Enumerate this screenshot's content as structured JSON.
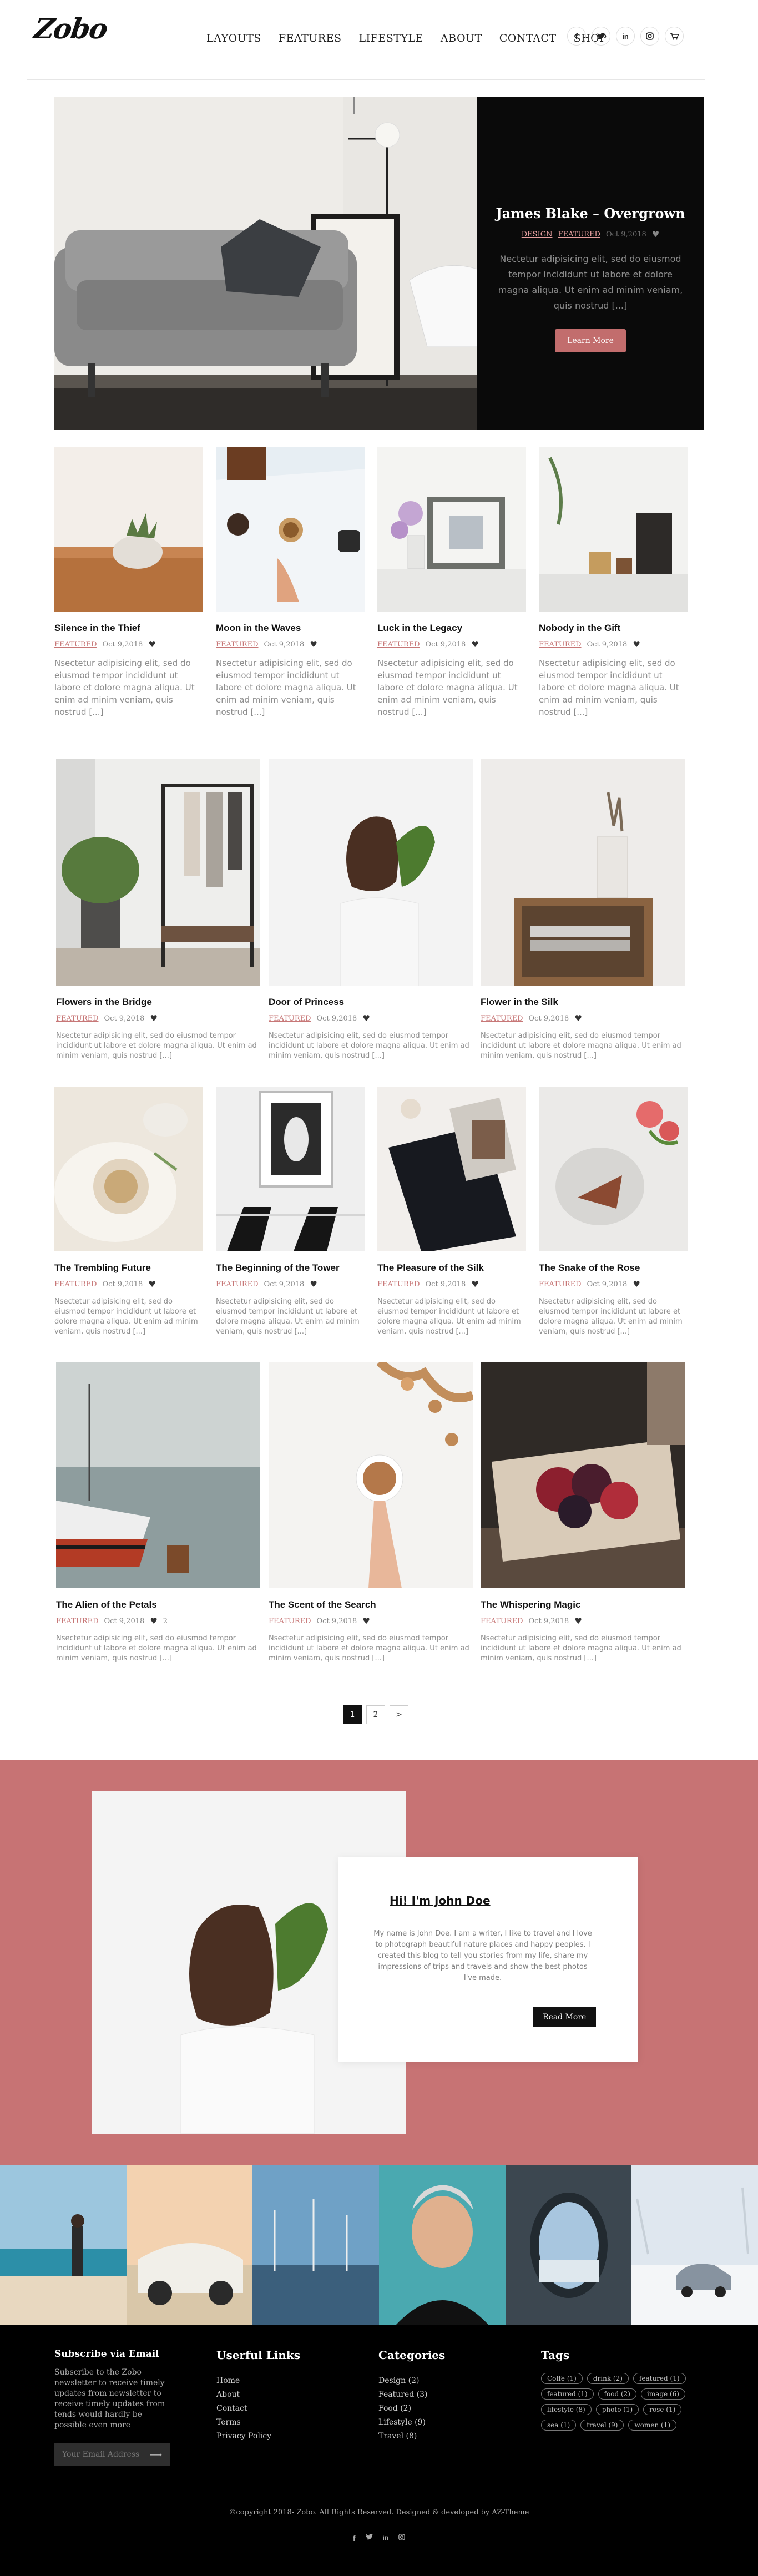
{
  "header": {
    "logo": "Zobo",
    "nav": [
      "LAYOUTS",
      "FEATURES",
      "LIFESTYLE",
      "ABOUT",
      "CONTACT",
      "SHOP"
    ],
    "social_icons": [
      "facebook-icon",
      "twitter-icon",
      "linkedin-icon",
      "instagram-icon",
      "cart-icon"
    ]
  },
  "hero": {
    "title": "James Blake – Overgrown",
    "categories": [
      "DESIGN",
      "FEATURED"
    ],
    "date": "Oct 9,2018",
    "excerpt": "Nectetur adipisicing elit, sed do eiusmod tempor incididunt ut labore et dolore magna aliqua. Ut enim ad minim veniam, quis nostrud [...]",
    "button": "Learn More"
  },
  "row1": [
    {
      "title": "Silence in the Thief",
      "category": "FEATURED",
      "date": "Oct 9,2018",
      "excerpt": "Nsectetur adipisicing elit, sed do eiusmod tempor incididunt ut labore et dolore magna aliqua. Ut enim ad minim veniam, quis nostrud [...]"
    },
    {
      "title": "Moon in the Waves",
      "category": "FEATURED",
      "date": "Oct 9,2018",
      "excerpt": "Nsectetur adipisicing elit, sed do eiusmod tempor incididunt ut labore et dolore magna aliqua. Ut enim ad minim veniam, quis nostrud [...]"
    },
    {
      "title": "Luck in the Legacy",
      "category": "FEATURED",
      "date": "Oct 9,2018",
      "excerpt": "Nsectetur adipisicing elit, sed do eiusmod tempor incididunt ut labore et dolore magna aliqua. Ut enim ad minim veniam, quis nostrud [...]"
    },
    {
      "title": "Nobody in the Gift",
      "category": "FEATURED",
      "date": "Oct 9,2018",
      "excerpt": "Nsectetur adipisicing elit, sed do eiusmod tempor incididunt ut labore et dolore magna aliqua. Ut enim ad minim veniam, quis nostrud [...]"
    }
  ],
  "row2": [
    {
      "title": "Flowers in the Bridge",
      "category": "FEATURED",
      "date": "Oct 9,2018",
      "excerpt": "Nsectetur adipisicing elit, sed do eiusmod tempor incididunt ut labore et dolore magna aliqua. Ut enim ad minim veniam, quis nostrud [...]"
    },
    {
      "title": "Door of Princess",
      "category": "FEATURED",
      "date": "Oct 9,2018",
      "excerpt": "Nsectetur adipisicing elit, sed do eiusmod tempor incididunt ut labore et dolore magna aliqua. Ut enim ad minim veniam, quis nostrud [...]"
    },
    {
      "title": "Flower in the Silk",
      "category": "FEATURED",
      "date": "Oct 9,2018",
      "excerpt": "Nsectetur adipisicing elit, sed do eiusmod tempor incididunt ut labore et dolore magna aliqua. Ut enim ad minim veniam, quis nostrud [...]"
    }
  ],
  "row3": [
    {
      "title": "The Trembling Future",
      "category": "FEATURED",
      "date": "Oct 9,2018",
      "excerpt": "Nsectetur adipisicing elit, sed do eiusmod tempor incididunt ut labore et dolore magna aliqua. Ut enim ad minim veniam, quis nostrud [...]"
    },
    {
      "title": "The Beginning of the Tower",
      "category": "FEATURED",
      "date": "Oct 9,2018",
      "excerpt": "Nsectetur adipisicing elit, sed do eiusmod tempor incididunt ut labore et dolore magna aliqua. Ut enim ad minim veniam, quis nostrud [...]"
    },
    {
      "title": "The Pleasure of the Silk",
      "category": "FEATURED",
      "date": "Oct 9,2018",
      "excerpt": "Nsectetur adipisicing elit, sed do eiusmod tempor incididunt ut labore et dolore magna aliqua. Ut enim ad minim veniam, quis nostrud [...]"
    },
    {
      "title": "The Snake of the Rose",
      "category": "FEATURED",
      "date": "Oct 9,2018",
      "excerpt": "Nsectetur adipisicing elit, sed do eiusmod tempor incididunt ut labore et dolore magna aliqua. Ut enim ad minim veniam, quis nostrud [...]"
    }
  ],
  "row4": [
    {
      "title": "The Alien of the Petals",
      "category": "FEATURED",
      "date": "Oct 9,2018",
      "likes": "2",
      "excerpt": "Nsectetur adipisicing elit, sed do eiusmod tempor incididunt ut labore et dolore magna aliqua. Ut enim ad minim veniam, quis nostrud [...]"
    },
    {
      "title": "The Scent of the Search",
      "category": "FEATURED",
      "date": "Oct 9,2018",
      "excerpt": "Nsectetur adipisicing elit, sed do eiusmod tempor incididunt ut labore et dolore magna aliqua. Ut enim ad minim veniam, quis nostrud [...]"
    },
    {
      "title": "The Whispering Magic",
      "category": "FEATURED",
      "date": "Oct 9,2018",
      "excerpt": "Nsectetur adipisicing elit, sed do eiusmod tempor incididunt ut labore et dolore magna aliqua. Ut enim ad minim veniam, quis nostrud [...]"
    }
  ],
  "pagination": [
    "1",
    "2",
    ">"
  ],
  "about": {
    "title": "Hi! I'm John Doe",
    "text": "My name is John Doe. I am a writer, I like to travel and I love to photograph beautiful nature places and happy peoples. I created this blog to tell you stories from my life, share my impressions of trips and travels and show the best photos I've made.",
    "button": "Read More"
  },
  "footer": {
    "subscribe_title": "Subscribe via Email",
    "subscribe_text": "Subscribe to the Zobo newsletter to receive timely updates from newsletter to receive timely updates from tends would hardly be possible even more",
    "email_placeholder": "Your Email Address",
    "links_title": "Userful Links",
    "links": [
      "Home",
      "About",
      "Contact",
      "Terms",
      "Privacy Policy"
    ],
    "categories_title": "Categories",
    "categories": [
      "Design (2)",
      "Featured (3)",
      "Food (2)",
      "Lifestyle (9)",
      "Travel (8)"
    ],
    "tags_title": "Tags",
    "tags": [
      "Coffe (1)",
      "drink (2)",
      "featured (1)",
      "featured (1)",
      "food (2)",
      "image (6)",
      "lifestyle (8)",
      "photo (1)",
      "rose (1)",
      "sea (1)",
      "travel (9)",
      "women (1)"
    ],
    "copyright": "©copyright 2018- Zobo. All Rights Reserved. Designed & developed by AZ-Theme",
    "social_icons": [
      "facebook-icon",
      "twitter-icon",
      "linkedin-icon",
      "instagram-icon"
    ]
  },
  "colors": {
    "accent": "#c77374",
    "button": "#c26d6d",
    "category": "#c77777",
    "footer_bg": "#000000"
  }
}
